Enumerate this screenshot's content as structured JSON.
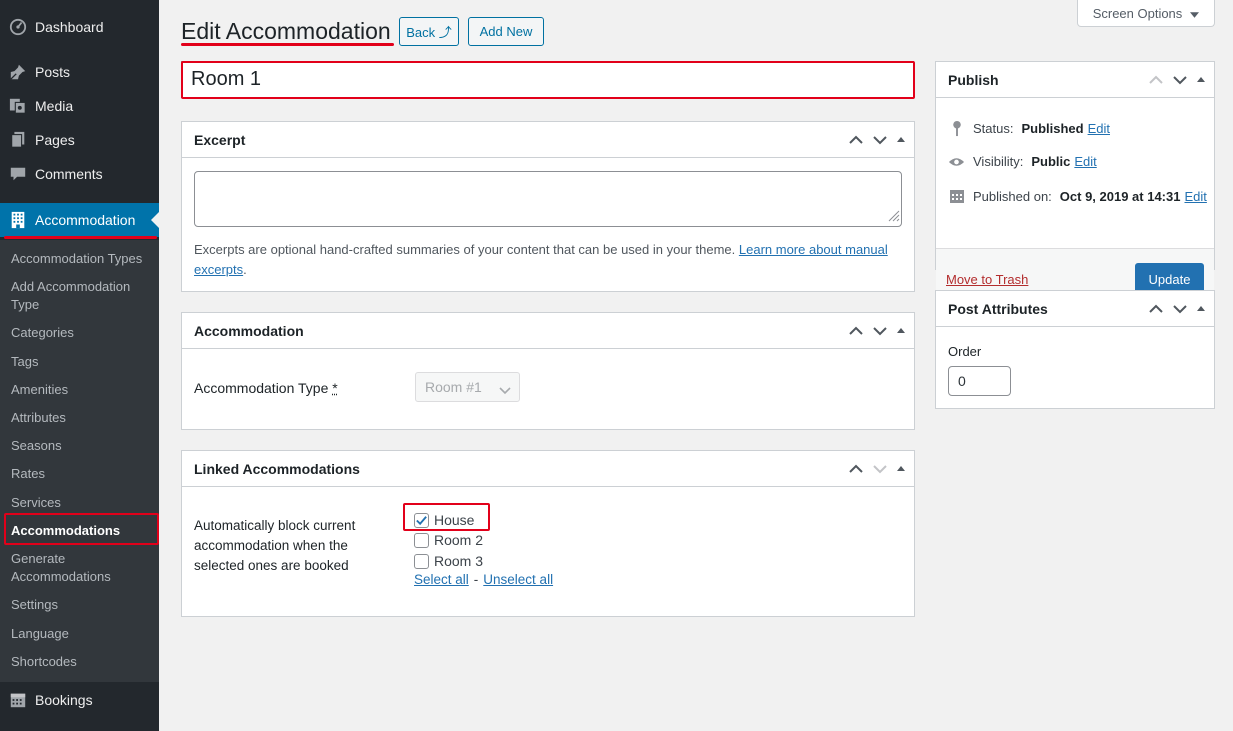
{
  "sidebar": {
    "dashboard": "Dashboard",
    "posts": "Posts",
    "media": "Media",
    "pages": "Pages",
    "comments": "Comments",
    "accommodation": "Accommodation",
    "bookings": "Bookings",
    "submenu": [
      "Accommodation Types",
      "Add Accommodation Type",
      "Categories",
      "Tags",
      "Amenities",
      "Attributes",
      "Seasons",
      "Rates",
      "Services",
      "Accommodations",
      "Generate Accommodations",
      "Settings",
      "Language",
      "Shortcodes"
    ]
  },
  "header": {
    "title": "Edit Accommodation",
    "back_label": "Back ⤴",
    "add_new_label": "Add New",
    "screen_options": "Screen Options"
  },
  "post": {
    "title": "Room 1"
  },
  "excerpt": {
    "heading": "Excerpt",
    "value": "",
    "description": "Excerpts are optional hand-crafted summaries of your content that can be used in your theme.",
    "learn_more": "Learn more about manual excerpts"
  },
  "accommodation_box": {
    "heading": "Accommodation",
    "type_label": "Accommodation Type",
    "required_mark": "*",
    "type_value": "Room #1"
  },
  "linked": {
    "heading": "Linked Accommodations",
    "label": "Automatically block current accommodation when the selected ones are booked",
    "options": [
      {
        "label": "House",
        "checked": true
      },
      {
        "label": "Room 2",
        "checked": false
      },
      {
        "label": "Room 3",
        "checked": false
      }
    ],
    "select_all": "Select all",
    "separator": "-",
    "unselect_all": "Unselect all"
  },
  "publish": {
    "heading": "Publish",
    "status_label": "Status:",
    "status_value": "Published",
    "visibility_label": "Visibility:",
    "visibility_value": "Public",
    "published_label": "Published on:",
    "published_value": "Oct 9, 2019 at 14:31",
    "edit": "Edit",
    "trash": "Move to Trash",
    "update": "Update"
  },
  "attributes": {
    "heading": "Post Attributes",
    "order_label": "Order",
    "order_value": "0"
  },
  "colors": {
    "sidebar_bg": "#23282d",
    "submenu_bg": "#32373c",
    "accent": "#0073aa",
    "highlight_red": "#e2001a"
  }
}
